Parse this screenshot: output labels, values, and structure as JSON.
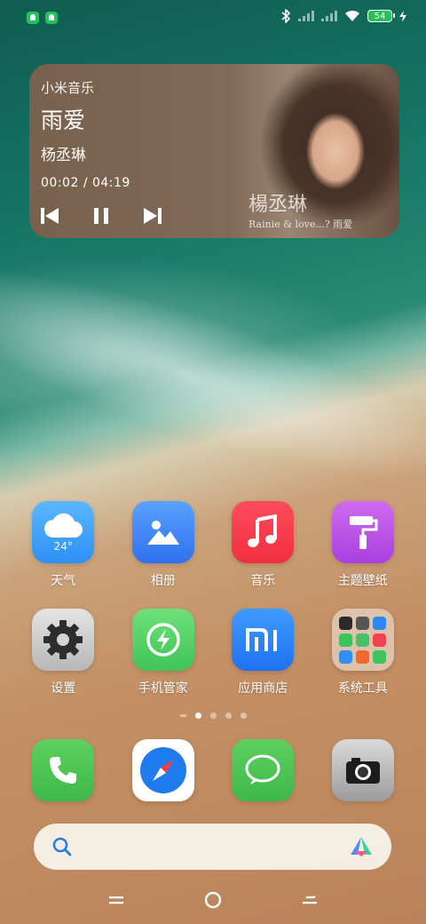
{
  "status_bar": {
    "notification_icons": [
      "notification-icon",
      "notification-icon"
    ],
    "battery_level": "54",
    "icons": [
      "bluetooth-icon",
      "signal-icon",
      "signal-icon",
      "wifi-icon",
      "charging-icon"
    ]
  },
  "music_widget": {
    "app_name": "小米音乐",
    "song_title": "雨爱",
    "artist": "杨丞琳",
    "current_time": "00:02",
    "separator": "/",
    "total_time": "04:19",
    "album_text_big": "楊丞琳",
    "album_text_small": "Rainie & love...? 雨爱",
    "controls": [
      "previous-icon",
      "pause-icon",
      "next-icon"
    ]
  },
  "apps_row1": [
    {
      "label": "天气",
      "icon": "weather-icon",
      "temp": "24°"
    },
    {
      "label": "相册",
      "icon": "gallery-icon"
    },
    {
      "label": "音乐",
      "icon": "music-icon"
    },
    {
      "label": "主题壁纸",
      "icon": "theme-icon"
    }
  ],
  "apps_row2": [
    {
      "label": "设置",
      "icon": "settings-icon"
    },
    {
      "label": "手机管家",
      "icon": "security-icon"
    },
    {
      "label": "应用商店",
      "icon": "app-store-icon"
    },
    {
      "label": "系统工具",
      "icon": "folder-icon"
    }
  ],
  "page_indicator": {
    "pages": 4,
    "active": 1
  },
  "dock": [
    "phone-icon",
    "browser-icon",
    "messages-icon",
    "camera-icon"
  ],
  "search": {
    "icons": [
      "search-icon",
      "assistant-icon"
    ]
  },
  "nav_bar": [
    "menu-icon",
    "home-icon",
    "back-icon"
  ],
  "colors": {
    "battery_fill": "#25c25a",
    "notification": "#21c45a"
  }
}
